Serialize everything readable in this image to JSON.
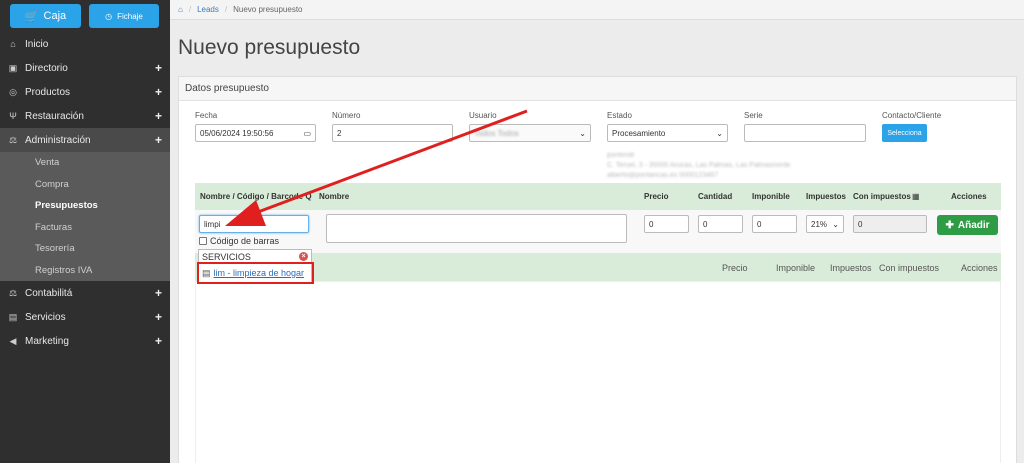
{
  "sidebar": {
    "caja_label": "Caja",
    "fichaje_label": "Fichaje",
    "items": [
      {
        "label": "Inicio",
        "icon": "home-icon",
        "plus": ""
      },
      {
        "label": "Directorio",
        "icon": "book-icon",
        "plus": "+"
      },
      {
        "label": "Productos",
        "icon": "box-icon",
        "plus": "+"
      },
      {
        "label": "Restauración",
        "icon": "cutlery-icon",
        "plus": "+"
      },
      {
        "label": "Administración",
        "icon": "scale-icon",
        "plus": "+"
      },
      {
        "label": "Contabilitá",
        "icon": "scale-icon",
        "plus": "+"
      },
      {
        "label": "Servicios",
        "icon": "briefcase-icon",
        "plus": "+"
      },
      {
        "label": "Marketing",
        "icon": "megaphone-icon",
        "plus": "+"
      }
    ],
    "submenu": [
      "Venta",
      "Compra",
      "Presupuestos",
      "Facturas",
      "Tesorería",
      "Registros IVA"
    ]
  },
  "breadcrumb": {
    "home": "⌂",
    "leads": "Leads",
    "current": "Nuevo presupuesto"
  },
  "page_title": "Nuevo presupuesto",
  "panel": {
    "title": "Datos presupuesto",
    "fecha": {
      "label": "Fecha",
      "value": "05/06/2024 19:50:56"
    },
    "numero": {
      "label": "Número",
      "value": "2"
    },
    "usuario": {
      "label": "Usuario",
      "value": "Todos Todos"
    },
    "estado": {
      "label": "Estado",
      "value": "Procesamiento"
    },
    "serie": {
      "label": "Serie",
      "value": ""
    },
    "contacto": {
      "label": "Contacto/Cliente",
      "button": "Selecciona"
    },
    "contact_info": [
      "pontendr",
      "C. Teruel, 3 - 35000 Arucas, Las Palmas, Las Palmasnorde",
      "alberto@pontaricas.es 0000123467"
    ]
  },
  "lines_table": {
    "headers": {
      "nombre_codigo": "Nombre / Código / Barcode Q",
      "nombre": "Nombre",
      "precio": "Precio",
      "cantidad": "Cantidad",
      "imponible": "Imponible",
      "impuestos": "Impuestos",
      "con_impuestos": "Con impuestos",
      "acciones": "Acciones"
    },
    "row": {
      "search_value": "limpi",
      "precio": "0",
      "cantidad": "0",
      "imponible": "0",
      "impuestos": "21%",
      "con_impuestos": "0",
      "add_button": "Añadir"
    }
  },
  "autocomplete": {
    "barcode_checkbox": "Código de barras",
    "group": "SERVICIOS",
    "option": "lim - limpieza de hogar"
  },
  "items_table": {
    "headers": [
      "Precio",
      "Imponible",
      "Impuestos",
      "Con impuestos",
      "Acciones"
    ]
  },
  "colors": {
    "accent": "#2aa3e8",
    "add": "#2e9b45",
    "header_green": "#d9ecd9",
    "annotation": "#e01f1f"
  }
}
